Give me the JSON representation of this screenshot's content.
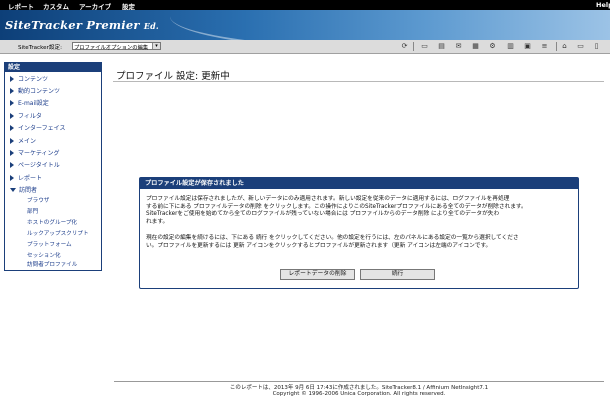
{
  "topnav": {
    "items": [
      "レポート",
      "カスタム",
      "アーカイブ",
      "設定"
    ],
    "help": "Help"
  },
  "banner": {
    "logo_main": "SiteTracker Premier",
    "logo_ed": "Ed."
  },
  "toolbar": {
    "label": "SiteTracker設定:",
    "select_value": "プロファイルオプションの編集",
    "icons": [
      "refresh-icon",
      "print-icon",
      "export-icon",
      "email-icon",
      "calendar-icon",
      "settings-icon",
      "home-icon",
      "folder-icon",
      "bookmark-icon"
    ]
  },
  "sidebar": {
    "title": "設定",
    "items": [
      {
        "label": "コンテンツ"
      },
      {
        "label": "動的コンテンツ"
      },
      {
        "label": "E-mail設定"
      },
      {
        "label": "フィルタ"
      },
      {
        "label": "インターフェイス"
      },
      {
        "label": "メイン"
      },
      {
        "label": "マーケティング"
      },
      {
        "label": "ページタイトル"
      },
      {
        "label": "レポート"
      },
      {
        "label": "訪問者"
      }
    ],
    "subitems": [
      {
        "label": "ブラウザ"
      },
      {
        "label": "部門"
      },
      {
        "label": "ホストのグループ化"
      },
      {
        "label": "ルックアップスクリプト"
      },
      {
        "label": "プラットフォーム"
      },
      {
        "label": "セッション化"
      },
      {
        "label": "訪問者プロファイル"
      }
    ]
  },
  "main": {
    "title": "プロファイル 設定: 更新中"
  },
  "dialog": {
    "title": "プロファイル設定が保存されました",
    "para1_line1": "プロファイル設定は保存されましたが、新しいデータにのみ適用されます。新しい設定を従来のデータに適用するには、ログファイルを再処理",
    "para1_line2": "する前に下にある プロファイルデータの削除 をクリックします。この操作によりこのSiteTrackerプロファイルにある全てのデータが削除されます。",
    "para1_line3": "SiteTrackerをご使用を始めてから全てのログファイルが残っていない場合には プロファイルからのデータ削除 により全てのデータが失わ",
    "para1_line4": "れます。",
    "para2_line1": "現在の設定の編集を続けるには、下にある 続行 をクリックしてください。他の設定を行うには、左のパネルにある設定の一覧から選択してくださ",
    "para2_line2": "い。プロファイルを更新するには 更新 アイコンをクリックするとプロファイルが更新されます（更新 アイコンは左端のアイコンです。",
    "btn_delete": "レポートデータの削除",
    "btn_continue": "続行"
  },
  "footer": {
    "line1": "このレポートは、2013年 9月 6日 17:43に作成されました。SiteTracker8.1 / Affinium NetInsight7.1",
    "line2": "Copyright © 1996-2006 Unica Corporation. All rights reserved."
  }
}
